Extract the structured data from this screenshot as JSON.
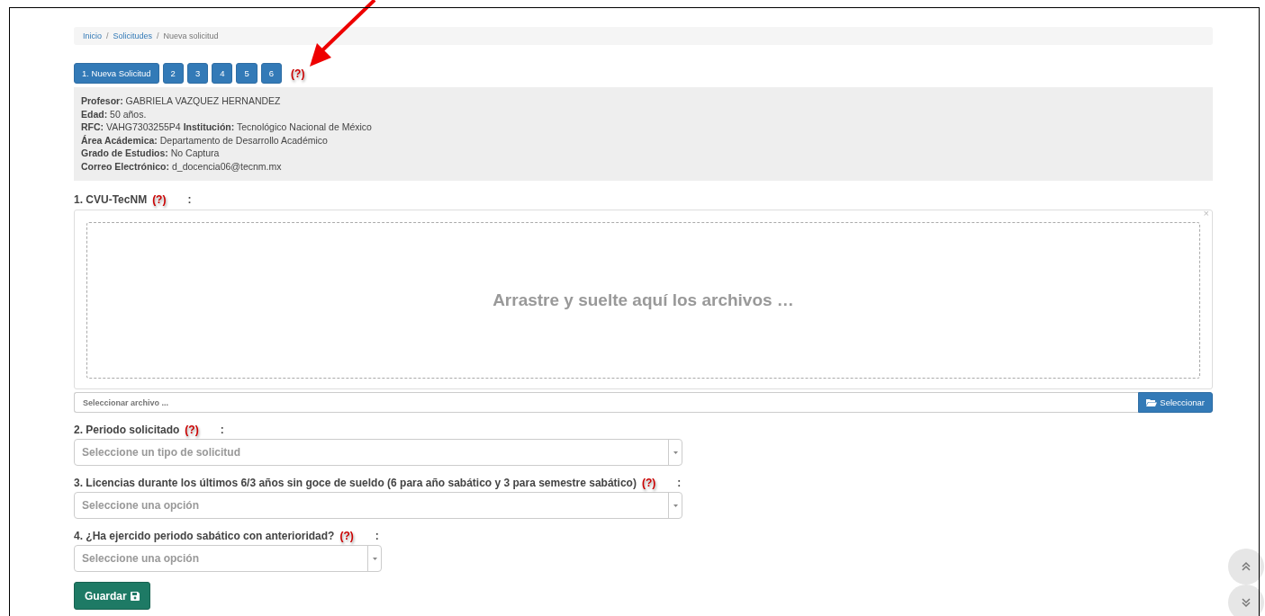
{
  "breadcrumb": [
    {
      "label": "Inicio",
      "link": true
    },
    {
      "label": "Solicitudes",
      "link": true
    },
    {
      "label": "Nueva solicitud",
      "link": false
    }
  ],
  "breadcrumb_separators": [
    "/",
    "/"
  ],
  "steps": {
    "tabs": [
      {
        "label": "1. Nueva Solicitud"
      },
      {
        "label": "2"
      },
      {
        "label": "3"
      },
      {
        "label": "4"
      },
      {
        "label": "5"
      },
      {
        "label": "6"
      }
    ],
    "help": "(?)"
  },
  "profile": [
    "**Profesor:** GABRIELA VAZQUEZ HERNANDEZ",
    "**Edad:** 50 años.",
    "**RFC:** VAHG7303255P4 **Institución:** Tecnológico Nacional de México",
    "**Área Acádemica:** Departamento de Desarrollo Académico",
    "**Grado de Estudios:** No Captura",
    "**Correo Electrónico:** d_docencia06@tecnm.mx"
  ],
  "upload": {
    "label": "1. CVU-TecNM",
    "help": "(?)",
    "colon": ":",
    "close": "×",
    "drop_text": "Arrastre y suelte aquí los archivos …",
    "file_placeholder": "Seleccionar archivo ...",
    "button": "Seleccionar"
  },
  "questions": [
    {
      "label": "2. Periodo solicitado",
      "help": "(?)",
      "colon": ":",
      "placeholder": "Seleccione un tipo de solicitud",
      "kind": "wide"
    },
    {
      "label": "3. Licencias durante los últimos 6/3 años sin goce de sueldo (6 para año sabático y 3 para semestre sabático)",
      "help": "(?)",
      "colon": ":",
      "placeholder": "Seleccione una opción",
      "kind": "wide"
    },
    {
      "label": "4. ¿Ha ejercido periodo sabático con anterioridad?",
      "help": "(?)",
      "colon": ":",
      "placeholder": "Seleccione una opción",
      "kind": "narrow"
    }
  ],
  "save_button": "Guardar"
}
